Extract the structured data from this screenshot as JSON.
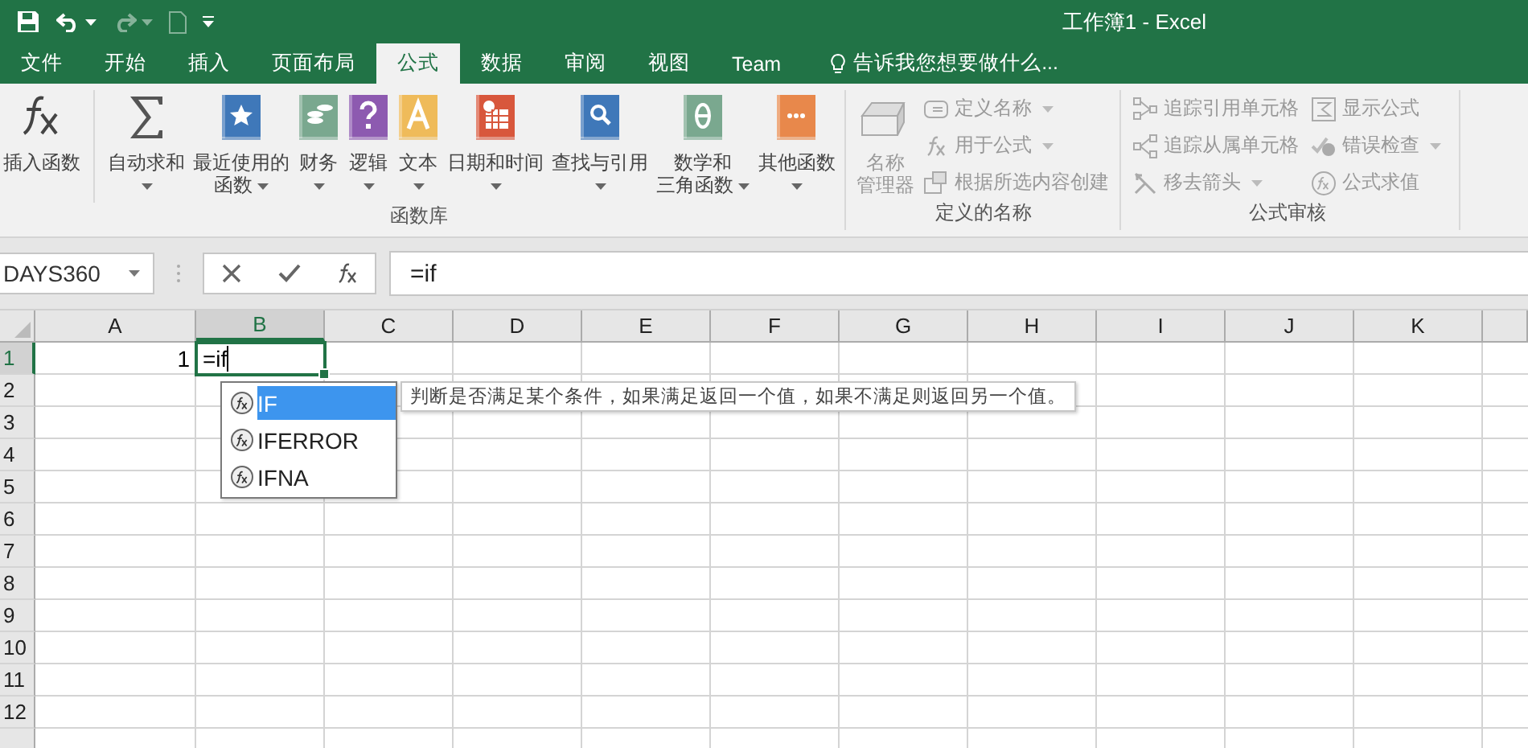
{
  "window": {
    "title": "工作簿1 - Excel"
  },
  "tabs": [
    {
      "label": "文件",
      "selected": false
    },
    {
      "label": "开始",
      "selected": false
    },
    {
      "label": "插入",
      "selected": false
    },
    {
      "label": "页面布局",
      "selected": false
    },
    {
      "label": "公式",
      "selected": true
    },
    {
      "label": "数据",
      "selected": false
    },
    {
      "label": "审阅",
      "selected": false
    },
    {
      "label": "视图",
      "selected": false
    },
    {
      "label": "Team",
      "selected": false
    }
  ],
  "tell_me": {
    "placeholder": "告诉我您想要做什么..."
  },
  "ribbon": {
    "groups": [
      {
        "label": "函数库",
        "large_buttons": [
          {
            "lines": [
              "插入函数"
            ],
            "dropdown": false
          },
          {
            "lines": [
              "自动求和"
            ],
            "dropdown": true
          },
          {
            "lines": [
              "最近使用的",
              "函数"
            ],
            "dropdown": true
          },
          {
            "lines": [
              "财务"
            ],
            "dropdown": true
          },
          {
            "lines": [
              "逻辑"
            ],
            "dropdown": true
          },
          {
            "lines": [
              "文本"
            ],
            "dropdown": true
          },
          {
            "lines": [
              "日期和时间"
            ],
            "dropdown": true
          },
          {
            "lines": [
              "查找与引用"
            ],
            "dropdown": true
          },
          {
            "lines": [
              "数学和",
              "三角函数"
            ],
            "dropdown": true
          },
          {
            "lines": [
              "其他函数"
            ],
            "dropdown": true
          }
        ]
      },
      {
        "label": "定义的名称",
        "large_buttons": [
          {
            "lines": [
              "名称",
              "管理器"
            ],
            "dropdown": false,
            "disabled": true
          }
        ],
        "small_columns": [
          [
            {
              "label": "定义名称",
              "dropdown": true,
              "disabled": true
            },
            {
              "label": "用于公式",
              "dropdown": true,
              "disabled": true
            },
            {
              "label": "根据所选内容创建",
              "dropdown": false,
              "disabled": true
            }
          ]
        ]
      },
      {
        "label": "公式审核",
        "small_columns": [
          [
            {
              "label": "追踪引用单元格",
              "dropdown": false,
              "disabled": true
            },
            {
              "label": "追踪从属单元格",
              "dropdown": false,
              "disabled": true
            },
            {
              "label": "移去箭头",
              "dropdown": true,
              "disabled": true
            }
          ],
          [
            {
              "label": "显示公式",
              "dropdown": false,
              "disabled": true
            },
            {
              "label": "错误检查",
              "dropdown": true,
              "disabled": true
            },
            {
              "label": "公式求值",
              "dropdown": false,
              "disabled": true
            }
          ]
        ]
      }
    ]
  },
  "name_box": {
    "value": "DAYS360"
  },
  "formula_bar": {
    "value": "=if"
  },
  "columns": [
    {
      "label": "A",
      "selected": false
    },
    {
      "label": "B",
      "selected": true
    },
    {
      "label": "C",
      "selected": false
    },
    {
      "label": "D",
      "selected": false
    },
    {
      "label": "E",
      "selected": false
    },
    {
      "label": "F",
      "selected": false
    },
    {
      "label": "G",
      "selected": false
    },
    {
      "label": "H",
      "selected": false
    },
    {
      "label": "I",
      "selected": false
    },
    {
      "label": "J",
      "selected": false
    },
    {
      "label": "K",
      "selected": false
    }
  ],
  "rows": [
    {
      "label": "1",
      "selected": true,
      "cells": [
        {
          "value": "1",
          "kind": "number"
        },
        {
          "value": "=if",
          "kind": "editing"
        }
      ]
    },
    {
      "label": "2",
      "selected": false
    },
    {
      "label": "3",
      "selected": false
    },
    {
      "label": "4",
      "selected": false
    },
    {
      "label": "5",
      "selected": false
    },
    {
      "label": "6",
      "selected": false
    },
    {
      "label": "7",
      "selected": false
    },
    {
      "label": "8",
      "selected": false
    },
    {
      "label": "9",
      "selected": false
    },
    {
      "label": "10",
      "selected": false
    },
    {
      "label": "11",
      "selected": false
    },
    {
      "label": "12",
      "selected": false
    }
  ],
  "autocomplete": {
    "items": [
      {
        "label": "IF",
        "selected": true
      },
      {
        "label": "IFERROR",
        "selected": false
      },
      {
        "label": "IFNA",
        "selected": false
      }
    ],
    "tooltip": "判断是否满足某个条件，如果满足返回一个值，如果不满足则返回另一个值。"
  }
}
